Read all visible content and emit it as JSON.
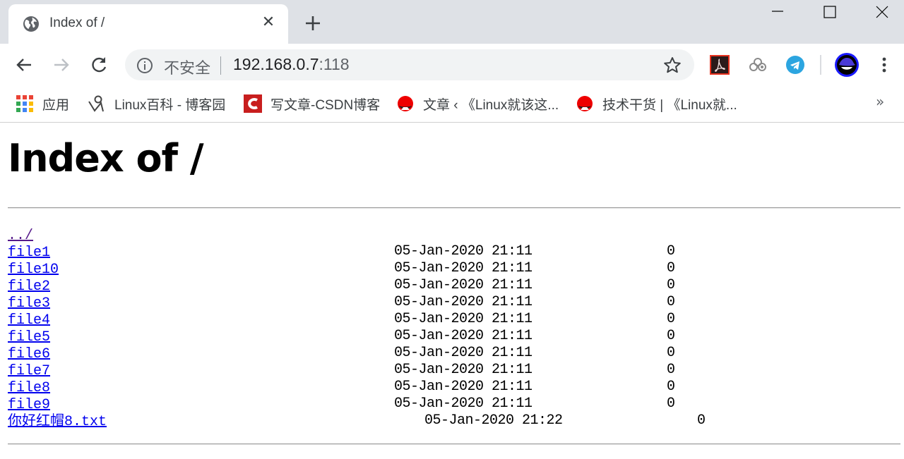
{
  "browser": {
    "tab": {
      "title": "Index of /",
      "icon": "globe-icon"
    },
    "window_controls": [
      "minimize",
      "maximize",
      "close"
    ],
    "toolbar": {
      "security_label": "不安全",
      "url_host": "192.168.0.7",
      "url_port": ":118"
    },
    "extensions": [
      "adobe-acrobat-icon",
      "cloud-extension-icon",
      "telegram-icon"
    ],
    "profile_icon": "redhat-avatar-icon",
    "bookmarks": [
      {
        "label": "应用",
        "icon": "apps-grid-icon"
      },
      {
        "label": "Linux百科 - 博客园",
        "icon": "cnblogs-icon"
      },
      {
        "label": "写文章-CSDN博客",
        "icon": "csdn-icon"
      },
      {
        "label": "文章 ‹ 《Linux就该这...",
        "icon": "redhat-icon"
      },
      {
        "label": "技术干货 | 《Linux就...",
        "icon": "redhat-icon"
      }
    ],
    "bookmarks_more": "»"
  },
  "page": {
    "heading": "Index of /",
    "parent_link": "../",
    "entries": [
      {
        "name": "file1",
        "date": "05-Jan-2020 21:11",
        "size": "0"
      },
      {
        "name": "file10",
        "date": "05-Jan-2020 21:11",
        "size": "0"
      },
      {
        "name": "file2",
        "date": "05-Jan-2020 21:11",
        "size": "0"
      },
      {
        "name": "file3",
        "date": "05-Jan-2020 21:11",
        "size": "0"
      },
      {
        "name": "file4",
        "date": "05-Jan-2020 21:11",
        "size": "0"
      },
      {
        "name": "file5",
        "date": "05-Jan-2020 21:11",
        "size": "0"
      },
      {
        "name": "file6",
        "date": "05-Jan-2020 21:11",
        "size": "0"
      },
      {
        "name": "file7",
        "date": "05-Jan-2020 21:11",
        "size": "0"
      },
      {
        "name": "file8",
        "date": "05-Jan-2020 21:11",
        "size": "0"
      },
      {
        "name": "file9",
        "date": "05-Jan-2020 21:11",
        "size": "0"
      },
      {
        "name": "你好红帽8.txt",
        "date": "05-Jan-2020 21:22",
        "size": "0"
      }
    ]
  },
  "colors": {
    "link": "#0000ee",
    "visited_link": "#551a8b",
    "tabstrip_bg": "#dee1e6",
    "omnibox_bg": "#f1f3f4"
  }
}
